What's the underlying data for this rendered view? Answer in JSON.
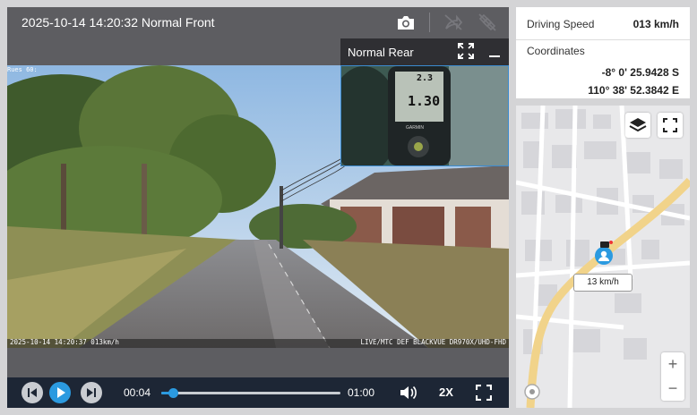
{
  "player": {
    "title": "2025-10-14 14:20:32 Normal Front",
    "icons": [
      "camera-icon",
      "share-icon",
      "satellite-icon"
    ],
    "video_overlay": {
      "top_left": "Rues 60:",
      "bottom_left": "2025-10-14 14:20:37 013km/h",
      "bottom_right": "LIVE/MTC DEF BLACKVUE DR970X/UHD-FHD"
    },
    "pip": {
      "label": "Normal Rear",
      "gauge_top": "2.3",
      "gauge_bottom": "1.30",
      "gauge_brand": "GARMIN"
    }
  },
  "controls": {
    "current_time": "00:04",
    "duration": "01:00",
    "progress": 0.067,
    "playback_rate": "2X"
  },
  "info": {
    "speed_label": "Driving Speed",
    "speed_value": "013 km/h",
    "coords_label": "Coordinates",
    "lat": "-8° 0' 25.9428 S",
    "lon": "110° 38' 52.3842 E"
  },
  "map": {
    "speed_tag": "13 km/h",
    "zoom_in": "+",
    "zoom_out": "−"
  },
  "colors": {
    "accent": "#2b9ae0",
    "controls_bg": "#1d2635",
    "player_bg": "#5d5d61",
    "road": "#f1d38a"
  }
}
